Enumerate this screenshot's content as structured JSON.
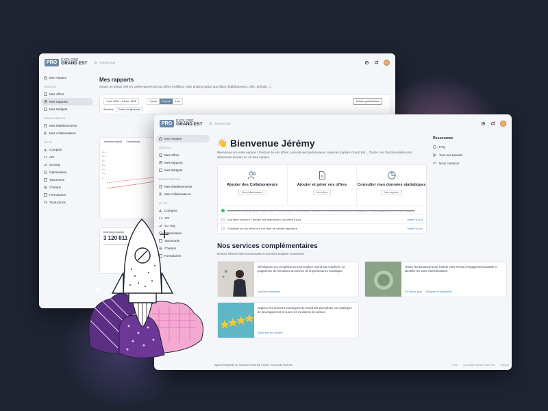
{
  "brand": {
    "pro": "PRO",
    "line1": "EXPLORE",
    "line2": "GRAND EST"
  },
  "search_placeholder": "Rechercher",
  "sidebar": {
    "home": "Mon espace",
    "section_services": "SERVICES",
    "services": [
      "Mes offres",
      "Mes rapports",
      "Mes Widgets"
    ],
    "section_admin": "ADMINISTRATION",
    "admin": [
      "Mes établissements",
      "Mes collaborateurs"
    ],
    "section_api": "API TB",
    "api": [
      "Comptes",
      "API",
      "Scoring",
      "Optimisation",
      "Taxonomie",
      "Champs",
      "Formulaires",
      "Traductions"
    ]
  },
  "reports": {
    "title": "Mes rapports",
    "subtitle": "Suivez en temps réel les performances de vos offres et affinez votre analyse grâce aux filtres (établissement, offre, période...).",
    "date_range": "1 oct. 2024 – 24 avr. 2025",
    "periods": [
      "7 jours",
      "30 jours",
      "1 an"
    ],
    "active_period": "30 jours",
    "previous": "Années précédentes",
    "session_label": "Sessions",
    "region_filter": "Toutes les géozones",
    "chart_tabs": [
      "Intention d'achat",
      "Conversions"
    ],
    "y_ticks": [
      "12 k",
      "10 k",
      "8 k",
      "6 k",
      "4 k",
      "2 k",
      "0"
    ],
    "stat_label": "Intentions d'achat",
    "stat_value": "3 120 811",
    "stat_text": "Le tauf % du panier est multiplié par 4..."
  },
  "home": {
    "wave": "👋",
    "welcome": "Bienvenue Jérémy",
    "intro": "Bienvenue sur votre espace ! Gestion de vos offres, suivi de leur performance, services Explore Grand Est... Toutes ces fonctionnalités sont désormais réunies en un seul espace.",
    "cards": [
      {
        "icon": "users-icon",
        "title": "Ajouter des Collaborateurs",
        "button": "Mes collaborateurs"
      },
      {
        "icon": "document-icon",
        "title": "Ajouter et gérer vos offres",
        "button": "Mes offres"
      },
      {
        "icon": "pie-chart-icon",
        "title": "Consulter mes données statistiques",
        "button": "Mes rapports"
      }
    ],
    "tasks": [
      {
        "text": "Vous n'avez déposé qu'une seule offre. Pour optimiser votre visibilité, déclinez de nouvelles offres selon les saisons, vos principales idées ou thématiques.",
        "link": "",
        "done": true
      },
      {
        "text": "Vos tarifs évoluent ? Mettez dès maintenant vos offres à jour",
        "link": "Mettre à jour",
        "done": false
      },
      {
        "text": "Certaines de vos offres ont une date de validité dépassée",
        "link": "Mettre à jour",
        "done": false
      }
    ],
    "services_title": "Nos services complémentaires",
    "services_sub": "Restez informé des nouveautés et services Explore Grand Est",
    "services": [
      {
        "text": "Développez vos compétences avec Explore Grand Est Académie, un programme de formations au service de la performance touristique.",
        "links": [
          "Voir les formations"
        ]
      },
      {
        "text": "Testez l'Ecoboussole pour évaluer votre niveau d'engagement durable et identifier les axes d'améliorations.",
        "links": [
          "En savoir plus",
          "Réaliser le diagnostic"
        ]
      },
      {
        "text": "Explorez les données touristiques du Grand Est pour piloter vos stratégies de développement et suivre les évolutions du secteur.",
        "links": [
          "Découvrir les études"
        ]
      }
    ]
  },
  "resources": {
    "title": "Ressources",
    "items": [
      "FAQ",
      "Tous nos tutoriels",
      "Nous contacter"
    ]
  },
  "footer": {
    "left": "Agence Régionale du Tourisme Grand Est ©2025 - Tous droits réservés",
    "right": [
      "CGU",
      "La Charte Explore Grand Est",
      "Support"
    ]
  },
  "colors": {
    "accent": "#6d8aa8",
    "link": "#2a7fc7",
    "background": "#1f2433"
  }
}
